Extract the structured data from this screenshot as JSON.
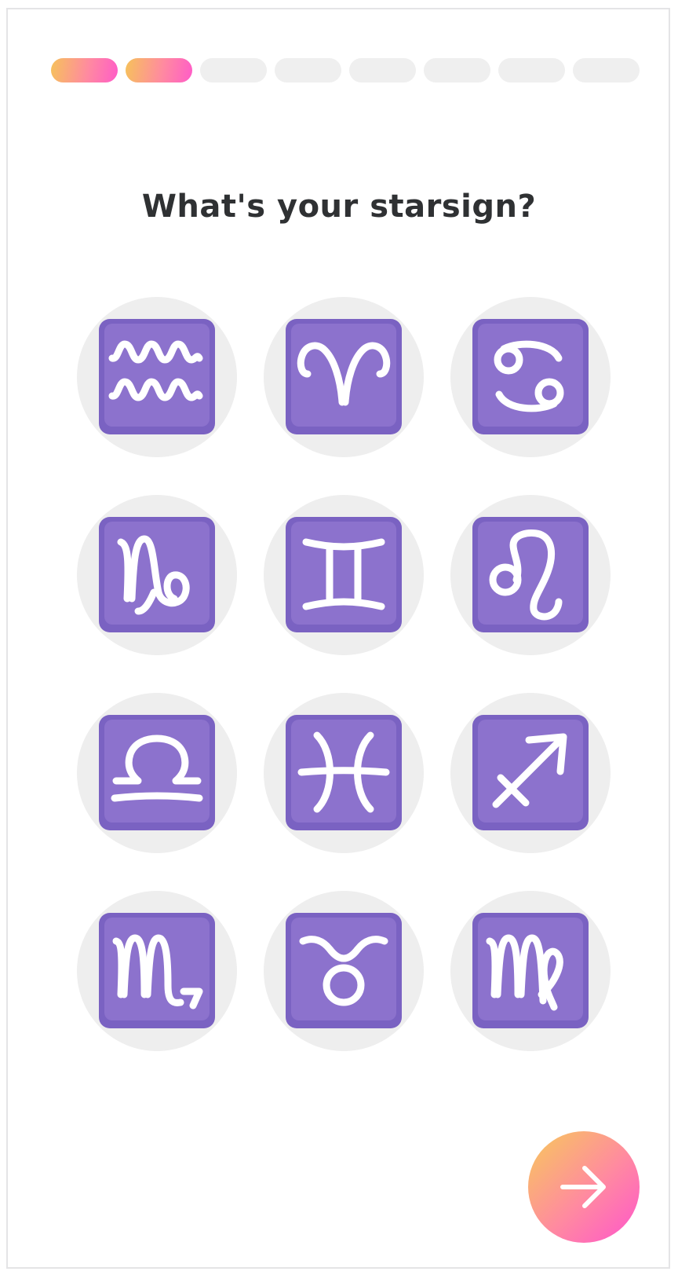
{
  "progress": {
    "total_steps": 8,
    "current_step": 2,
    "active_colors": [
      "#f6c25a",
      "#ff5cc8"
    ],
    "inactive_color": "#efefef"
  },
  "question": {
    "title": "What's your starsign?"
  },
  "signs": [
    {
      "id": "aquarius",
      "icon": "aquarius-icon"
    },
    {
      "id": "aries",
      "icon": "aries-icon"
    },
    {
      "id": "cancer",
      "icon": "cancer-icon"
    },
    {
      "id": "capricorn",
      "icon": "capricorn-icon"
    },
    {
      "id": "gemini",
      "icon": "gemini-icon"
    },
    {
      "id": "leo",
      "icon": "leo-icon"
    },
    {
      "id": "libra",
      "icon": "libra-icon"
    },
    {
      "id": "pisces",
      "icon": "pisces-icon"
    },
    {
      "id": "sagittarius",
      "icon": "sagittarius-icon"
    },
    {
      "id": "scorpio",
      "icon": "scorpio-icon"
    },
    {
      "id": "taurus",
      "icon": "taurus-icon"
    },
    {
      "id": "virgo",
      "icon": "virgo-icon"
    }
  ],
  "tile_color": "#8c72cd",
  "next_button": {
    "icon": "arrow-right-icon"
  }
}
